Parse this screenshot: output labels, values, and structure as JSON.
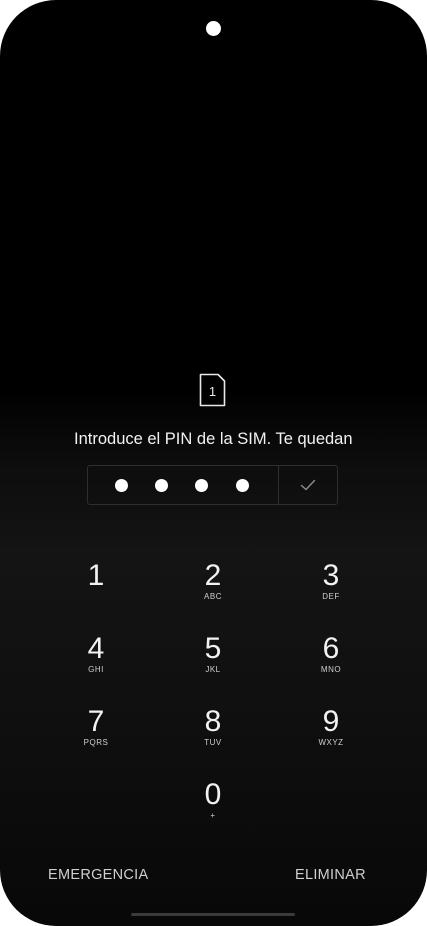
{
  "sim_card": {
    "icon": "sim-card-icon",
    "number": "1"
  },
  "prompt_text": "Introduce el PIN de la SIM. Te quedan",
  "pin": {
    "entered_digits": 4,
    "confirm_icon": "checkmark-icon"
  },
  "keypad": {
    "keys": [
      {
        "num": "1",
        "letters": ""
      },
      {
        "num": "2",
        "letters": "ABC"
      },
      {
        "num": "3",
        "letters": "DEF"
      },
      {
        "num": "4",
        "letters": "GHI"
      },
      {
        "num": "5",
        "letters": "JKL"
      },
      {
        "num": "6",
        "letters": "MNO"
      },
      {
        "num": "7",
        "letters": "PQRS"
      },
      {
        "num": "8",
        "letters": "TUV"
      },
      {
        "num": "9",
        "letters": "WXYZ"
      },
      {
        "num": "0",
        "letters": "+"
      }
    ]
  },
  "actions": {
    "emergency_label": "EMERGENCIA",
    "delete_label": "ELIMINAR"
  }
}
